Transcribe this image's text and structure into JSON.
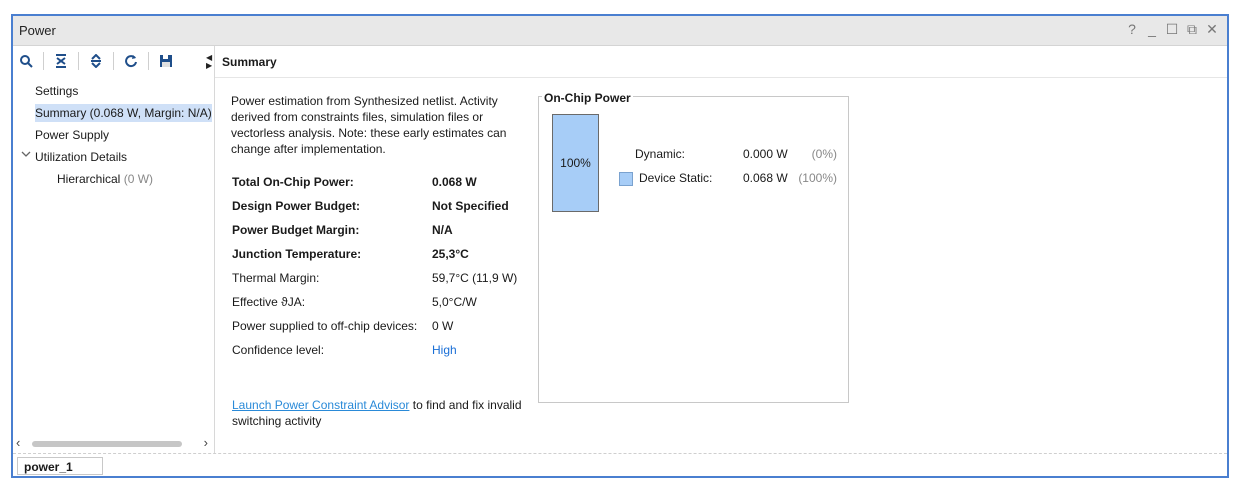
{
  "window": {
    "title": "Power",
    "controls": [
      "?",
      "_",
      "☐",
      "⧉",
      "✕"
    ]
  },
  "toolbar": {
    "icons": [
      "search-icon",
      "collapse-all-icon",
      "expand-all-icon",
      "refresh-icon",
      "save-icon"
    ]
  },
  "tree": {
    "settings": "Settings",
    "summary": "Summary (0.068 W, Margin: N/A)",
    "power_supply": "Power Supply",
    "utilization_details": "Utilization Details",
    "hierarchical": "Hierarchical",
    "hierarchical_value": "(0 W)"
  },
  "summary": {
    "header": "Summary",
    "description": "Power estimation from Synthesized netlist. Activity derived from constraints files, simulation files or vectorless analysis. Note: these early estimates can change after implementation.",
    "properties": [
      {
        "key": "Total On-Chip Power:",
        "value": "0.068 W"
      },
      {
        "key": "Design Power Budget:",
        "value": "Not Specified"
      },
      {
        "key": "Power Budget Margin:",
        "value": "N/A"
      },
      {
        "key": "Junction Temperature:",
        "value": "25,3°C"
      },
      {
        "key": "Thermal Margin:",
        "value": "59,7°C (11,9 W)"
      },
      {
        "key": "Effective ϑJA:",
        "value": "5,0°C/W"
      },
      {
        "key": "Power supplied to off-chip devices:",
        "value": "0 W"
      },
      {
        "key": "Confidence level:",
        "value": "High"
      }
    ],
    "advisor_link": "Launch Power Constraint Advisor",
    "advisor_text": " to find and fix invalid switching activity"
  },
  "onchip": {
    "title": "On-Chip Power",
    "bar_label": "100%",
    "bar_fraction": 1.0,
    "bar_color": "#a7cdf7",
    "rows": [
      {
        "name": "Dynamic:",
        "value": "0.000 W",
        "pct": "(0%)"
      },
      {
        "name": "Device Static:",
        "value": "0.068 W",
        "pct": "(100%)"
      }
    ]
  },
  "tabs": {
    "active": "power_1"
  }
}
